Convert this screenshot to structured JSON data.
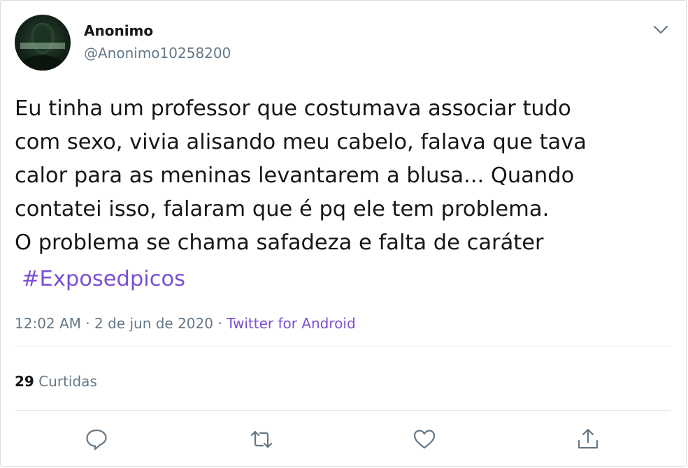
{
  "user": {
    "display_name": "Anonimo",
    "handle": "@Anonimo10258200",
    "avatar_icon": "anonymous-mask-avatar"
  },
  "tweet": {
    "text": "Eu tinha um professor que costumava associar tudo\ncom sexo, vivia alisando meu cabelo, falava que tava\ncalor para as meninas levantarem a blusa... Quando\ncontatei isso, falaram que é pq ele tem problema.\nO problema se chama safadeza e falta de caráter",
    "hashtag": "#Exposedpicos",
    "time": "12:02 AM",
    "date": "2 de jun de 2020",
    "separator": "·",
    "source": "Twitter for Android"
  },
  "stats": {
    "likes_count": "29",
    "likes_label": "Curtidas"
  },
  "actions": [
    {
      "name": "reply",
      "icon": "reply-icon"
    },
    {
      "name": "retweet",
      "icon": "retweet-icon"
    },
    {
      "name": "like",
      "icon": "heart-icon"
    },
    {
      "name": "share",
      "icon": "share-icon"
    }
  ],
  "colors": {
    "text": "#14171a",
    "secondary": "#657786",
    "link": "#7b4fcf",
    "divider": "#e1e8ed"
  }
}
